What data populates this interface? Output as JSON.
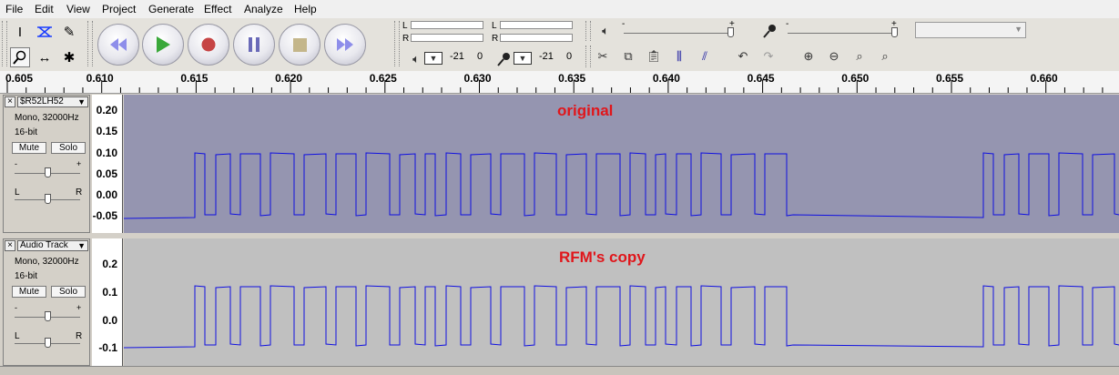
{
  "menu": [
    "File",
    "Edit",
    "View",
    "Project",
    "Generate",
    "Effect",
    "Analyze",
    "Help"
  ],
  "meters": {
    "left_label": "L",
    "right_label": "R",
    "playback_db": "-21",
    "playback_zero": "0",
    "record_db": "-21",
    "record_zero": "0"
  },
  "sliders": {
    "volume_minus": "-",
    "volume_plus": "+",
    "mic_minus": "-",
    "mic_plus": "+"
  },
  "ruler": {
    "labels": [
      "0.605",
      "0.610",
      "0.615",
      "0.620",
      "0.625",
      "0.630",
      "0.635",
      "0.640",
      "0.645",
      "0.650",
      "0.655",
      "0.660"
    ]
  },
  "tracks": [
    {
      "name": "$R52LH52",
      "info1": "Mono, 32000Hz",
      "info2": "16-bit",
      "mute": "Mute",
      "solo": "Solo",
      "gain_minus": "-",
      "gain_plus": "+",
      "pan_left": "L",
      "pan_right": "R",
      "scale": [
        "0.20",
        "0.15",
        "0.10",
        "0.05",
        "0.00",
        "-0.05"
      ],
      "annotation": "original",
      "background": "#9595b0",
      "wave_color": "#1010e0"
    },
    {
      "name": "Audio Track",
      "info1": "Mono, 32000Hz",
      "info2": "16-bit",
      "mute": "Mute",
      "solo": "Solo",
      "gain_minus": "-",
      "gain_plus": "+",
      "pan_left": "L",
      "pan_right": "R",
      "scale": [
        "0.2",
        "0.1",
        "0.0",
        "-0.1"
      ],
      "annotation": "RFM's copy",
      "background": "#c0c0c0",
      "wave_color": "#1010e0"
    }
  ],
  "icons": {
    "close": "×",
    "dropdown": "▼"
  }
}
